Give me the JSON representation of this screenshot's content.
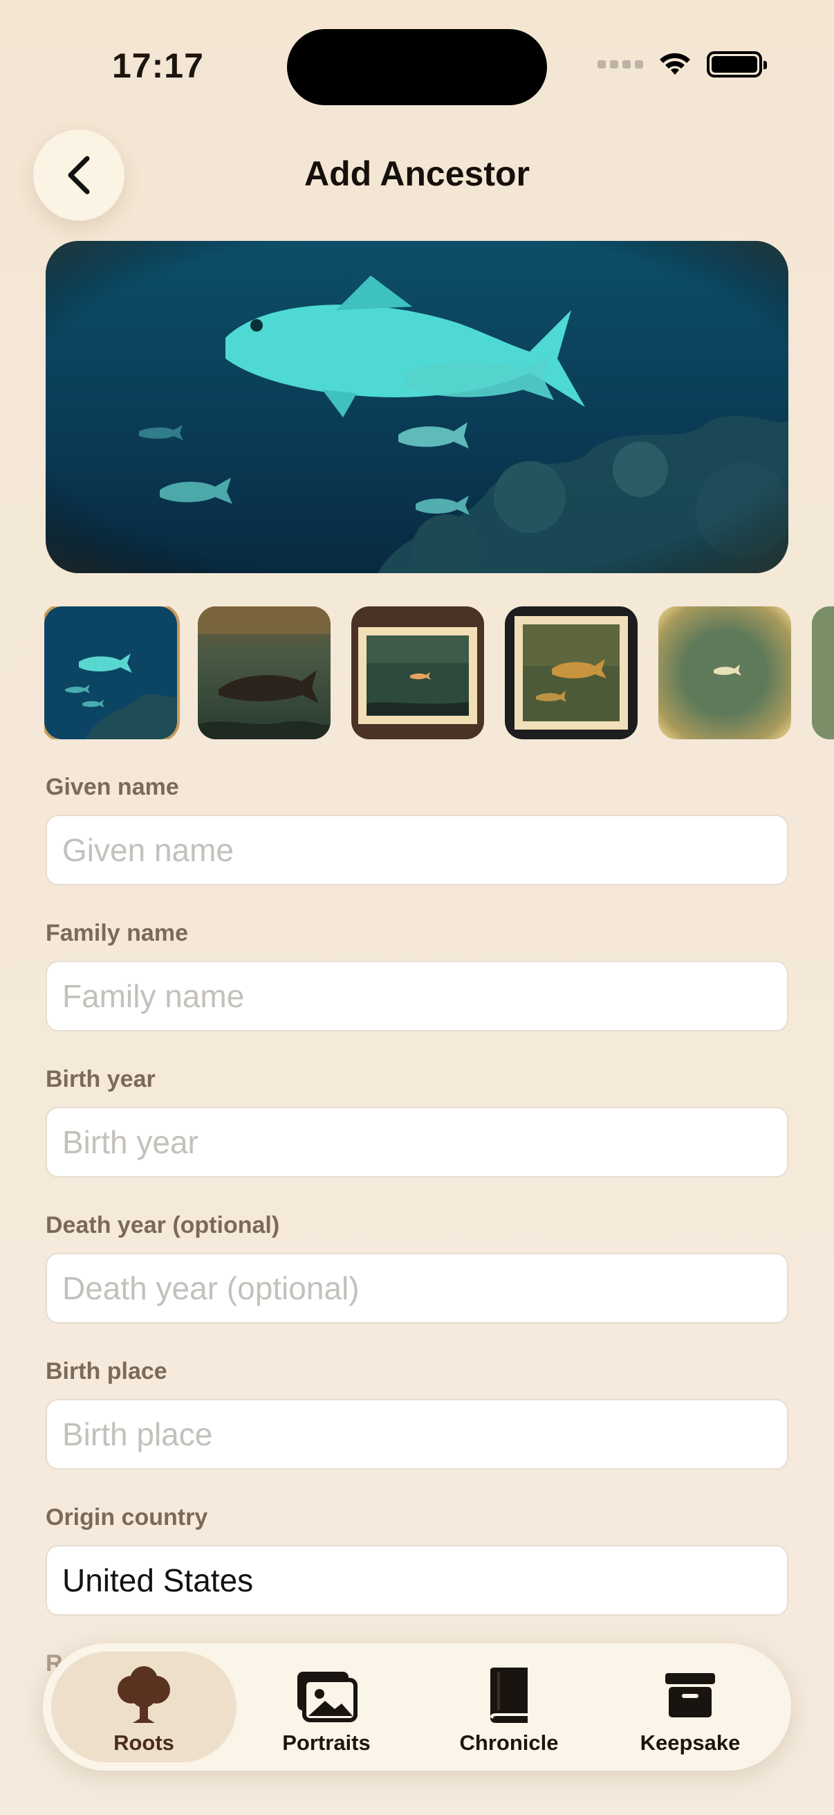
{
  "status_bar": {
    "time": "17:17"
  },
  "header": {
    "title": "Add Ancestor",
    "back_icon": "chevron-left-icon"
  },
  "hero": {
    "icon": "fish-photo"
  },
  "thumbnails": [
    {
      "name": "aquarium-school",
      "selected": true
    },
    {
      "name": "sepia-shark"
    },
    {
      "name": "framed-tank"
    },
    {
      "name": "vintage-print"
    },
    {
      "name": "faded-vignette"
    },
    {
      "name": "partial-thumbnail"
    }
  ],
  "form": {
    "given_name": {
      "label": "Given name",
      "placeholder": "Given name",
      "value": ""
    },
    "family_name": {
      "label": "Family name",
      "placeholder": "Family name",
      "value": ""
    },
    "birth_year": {
      "label": "Birth year",
      "placeholder": "Birth year",
      "value": ""
    },
    "death_year": {
      "label": "Death year (optional)",
      "placeholder": "Death year (optional)",
      "value": ""
    },
    "birth_place": {
      "label": "Birth place",
      "placeholder": "Birth place",
      "value": ""
    },
    "origin_country": {
      "label": "Origin country",
      "placeholder": "",
      "value": "United States"
    },
    "next_label_partial": "R"
  },
  "tabbar": {
    "tabs": [
      {
        "label": "Roots",
        "icon": "tree-icon",
        "active": true
      },
      {
        "label": "Portraits",
        "icon": "photos-icon"
      },
      {
        "label": "Chronicle",
        "icon": "book-icon"
      },
      {
        "label": "Keepsake",
        "icon": "archive-box-icon"
      }
    ]
  },
  "colors": {
    "background": "#f4e6d3",
    "accent": "#4b2c1a",
    "selected_border": "#c79b5a"
  }
}
